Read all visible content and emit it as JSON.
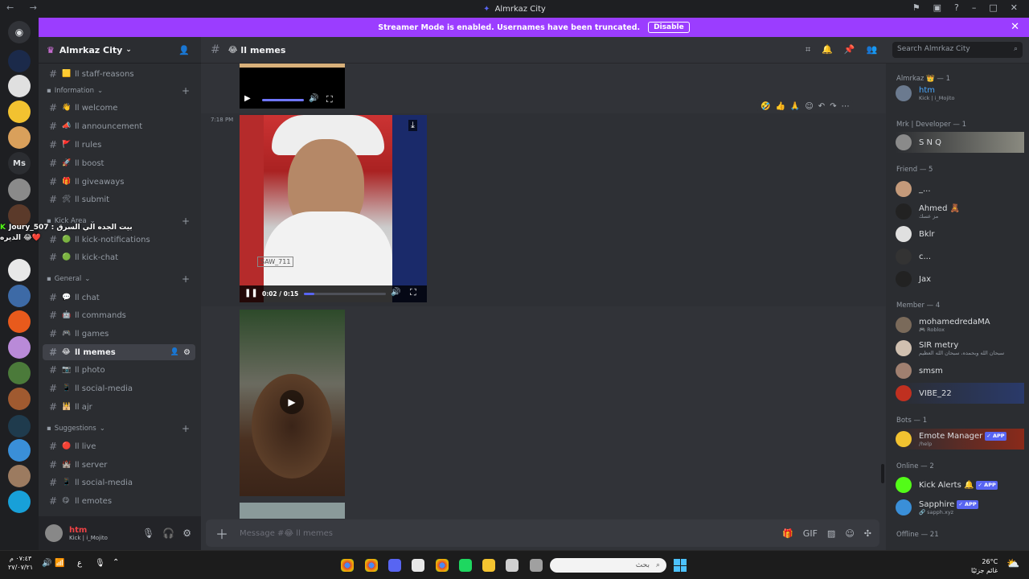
{
  "window": {
    "title": "Almrkaz City"
  },
  "banner": {
    "text": "Streamer Mode is enabled. Usernames have been truncated.",
    "button": "Disable"
  },
  "guild": {
    "name": "Almrkaz City"
  },
  "sidebar": {
    "channels_top": [
      {
        "label": "staff-reasons",
        "emoji": "🟨"
      }
    ],
    "categories": [
      {
        "name": "Information",
        "channels": [
          {
            "label": "welcome",
            "emoji": "👋"
          },
          {
            "label": "announcement",
            "emoji": "📣"
          },
          {
            "label": "rules",
            "emoji": "🚩"
          },
          {
            "label": "boost",
            "emoji": "🚀"
          },
          {
            "label": "giveaways",
            "emoji": "🎁"
          },
          {
            "label": "submit",
            "emoji": "🛠"
          }
        ]
      },
      {
        "name": "Kick Area",
        "channels": [
          {
            "label": "kick-notifications",
            "emoji": "🟢"
          },
          {
            "label": "kick-chat",
            "emoji": "🟢"
          }
        ]
      },
      {
        "name": "General",
        "channels": [
          {
            "label": "chat",
            "emoji": "💬"
          },
          {
            "label": "commands",
            "emoji": "🤖"
          },
          {
            "label": "games",
            "emoji": "🎮"
          },
          {
            "label": "memes",
            "emoji": "😂",
            "selected": true
          },
          {
            "label": "photo",
            "emoji": "📷"
          },
          {
            "label": "social-media",
            "emoji": "📱"
          },
          {
            "label": "ajr",
            "emoji": "🕌"
          }
        ]
      },
      {
        "name": "Suggestions",
        "channels": [
          {
            "label": "live",
            "emoji": "🔴"
          },
          {
            "label": "server",
            "emoji": "🏰"
          },
          {
            "label": "social-media",
            "emoji": "📱"
          },
          {
            "label": "emotes",
            "emoji": "😋"
          }
        ]
      }
    ],
    "prefix": "ll",
    "overlay": {
      "text": "Joury_507 : بيت الجده الي السرق",
      "text2": "الديره"
    }
  },
  "user_panel": {
    "name": "htm",
    "status": "Kick | i_Mojito"
  },
  "channel": {
    "name": "memes",
    "prefix": "ll",
    "search_placeholder": "Search Almrkaz City"
  },
  "messages": {
    "timestamp": "7:18 PM",
    "video": {
      "time": "0:02 / 0:15",
      "progress": 0.13,
      "watermark": "SAW_711"
    },
    "reactions": [
      "🤣",
      "👍",
      "🙏"
    ]
  },
  "composer": {
    "placeholder": "Message #😂 ll memes"
  },
  "members": {
    "groups": [
      {
        "title": "Almrkaz 👑 — 1",
        "items": [
          {
            "name": "htm",
            "sub": "Kick | i_Mojito",
            "color": "#4aa8ff"
          }
        ]
      },
      {
        "title": "Mrk | Developer — 1",
        "items": [
          {
            "name": "S N Q",
            "sub": "",
            "color": "#dbdee1"
          }
        ]
      },
      {
        "title": "Friend — 5",
        "items": [
          {
            "name": "_...",
            "sub": "",
            "color": "#dbdee1"
          },
          {
            "name": "Ahmed 🧸",
            "sub": "مز عسك",
            "color": "#dbdee1"
          },
          {
            "name": "Bklr",
            "sub": "",
            "color": "#dbdee1"
          },
          {
            "name": "c...",
            "sub": "",
            "color": "#dbdee1"
          },
          {
            "name": "Jax",
            "sub": "",
            "color": "#dbdee1"
          }
        ]
      },
      {
        "title": "Member — 4",
        "items": [
          {
            "name": "mohamedredaMA",
            "sub": "🎮 Roblox",
            "color": "#dbdee1"
          },
          {
            "name": "SIR metry",
            "sub": "سبحان الله وبحمده، سبحان الله العظيم",
            "color": "#dbdee1"
          },
          {
            "name": "smsm",
            "sub": "",
            "color": "#dbdee1"
          },
          {
            "name": "VIBE_22",
            "sub": "",
            "color": "#dbdee1"
          }
        ]
      },
      {
        "title": "Bots — 1",
        "items": [
          {
            "name": "Emote Manager",
            "sub": "/help",
            "color": "#dbdee1",
            "app": "✓ APP"
          }
        ]
      },
      {
        "title": "Online — 2",
        "items": [
          {
            "name": "Kick Alerts 🔔",
            "sub": "",
            "color": "#dbdee1",
            "app": "✓ APP"
          },
          {
            "name": "Sapphire",
            "sub": "🔗 sapph.xyz",
            "color": "#dbdee1",
            "app": "✓ APP"
          }
        ]
      },
      {
        "title": "Offline — 21",
        "items": []
      }
    ]
  },
  "taskbar": {
    "time": "٠٧:٤٣ م",
    "date": "٢٧/٠٧/٢١",
    "weather": "26°C",
    "weather_sub": "غائم جزئيًا",
    "search": "بحث",
    "lang": "ع"
  }
}
